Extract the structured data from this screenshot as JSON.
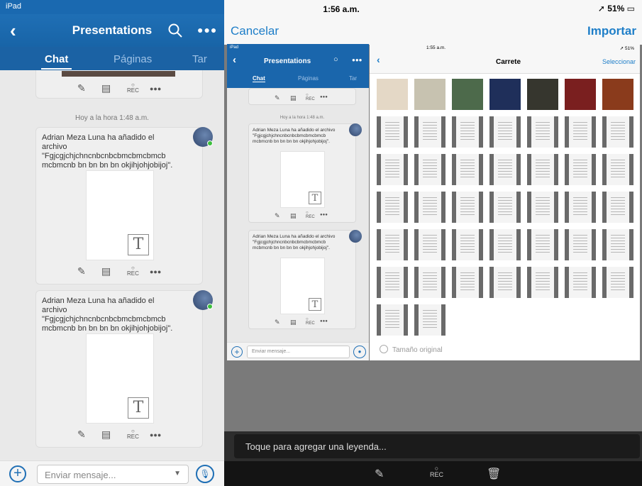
{
  "left": {
    "status": "iPad",
    "title": "Presentations",
    "tabs": [
      "Chat",
      "Páginas",
      "Tar"
    ],
    "timestamp": "Hoy a la hora 1:48 a.m.",
    "message_text": "Adrian Meza Luna ha añadido el archivo \"Fgjcgjchjchncnbcnbcbmcbmcbmcb mcbmcnb bn bn bn bn okjihjohjobijoj\".",
    "actions_rec": "REC",
    "input_placeholder": "Enviar mensaje..."
  },
  "right": {
    "time": "1:56 a.m.",
    "battery": "51%",
    "cancel": "Cancelar",
    "import": "Importar",
    "caption_placeholder": "Toque para agregar una leyenda...",
    "rec": "REC"
  },
  "preview": {
    "left_status": "iPad",
    "title": "Presentations",
    "tabs": [
      "Chat",
      "Páginas",
      "Tar"
    ],
    "timestamp": "Hoy a la hora 1:48 a.m.",
    "message_text": "Adrian Meza Luna ha añadido el archivo \"Fgjcgjchjchncnbcnbcbmcbmcbmcb mcbmcnb bn bn bn bn okjihjohjobijoj\".",
    "rec": "REC",
    "input_placeholder": "Enviar mensaje...",
    "right_time": "1:55 a.m.",
    "right_battery": "51%",
    "album_title": "Carrete",
    "select": "Seleccionar",
    "original_size": "Tamaño original"
  }
}
